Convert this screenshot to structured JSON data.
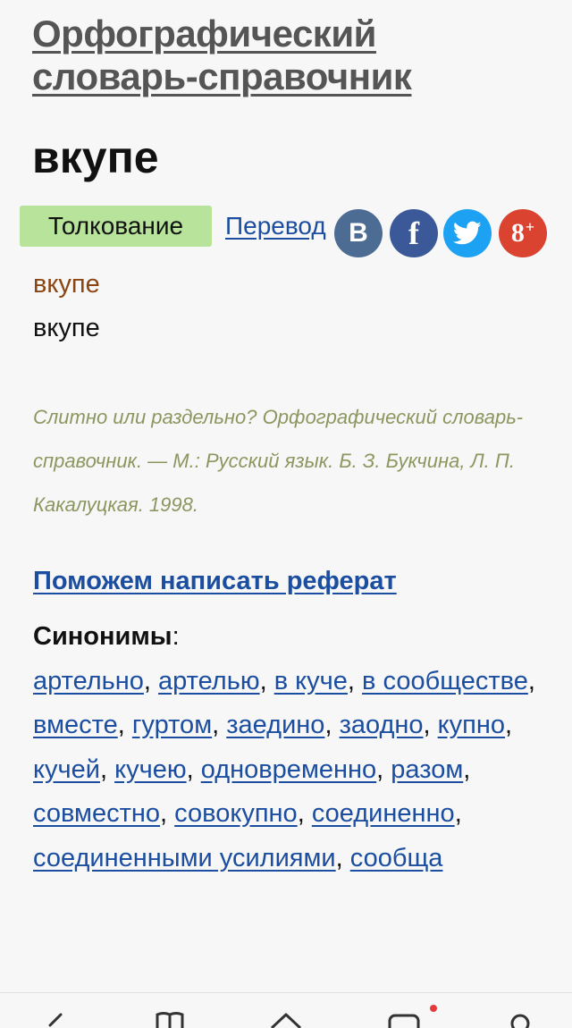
{
  "dictionary_title": "Орфографический словарь-справочник",
  "headword": "вкупе",
  "tabs": {
    "active": "Толкование",
    "link": "Перевод"
  },
  "social": {
    "vk": "В",
    "fb": "f",
    "gp": "8",
    "gp_plus": "+"
  },
  "entry": {
    "word": "вкупе",
    "text": "вкупе"
  },
  "source": "Слитно или раздельно? Орфографический словарь-справочник. — М.: Русский язык. Б. З. Букчина, Л. П. Какалуцкая. 1998.",
  "referat_link": "Поможем написать реферат",
  "synonyms": {
    "label": "Синонимы",
    "items": [
      "артельно",
      "артелью",
      "в куче",
      "в сообществе",
      "вместе",
      "гуртом",
      "заедино",
      "заодно",
      "купно",
      "кучей",
      "кучею",
      "одновременно",
      "разом",
      "совместно",
      "совокупно",
      "соединенно",
      "соединенными усилиями",
      "сообща"
    ]
  },
  "colors": {
    "link": "#1b4ea0",
    "entry_word": "#8b4513",
    "source": "#8c9760",
    "active_tab": "#b7e39a",
    "vk": "#4d6c93",
    "facebook": "#3b5998",
    "twitter": "#1da1f2",
    "google_plus": "#d9432f"
  },
  "bottom_nav": {
    "icons": [
      "back-icon",
      "bookmarks-icon",
      "home-icon",
      "tabs-icon",
      "profile-icon"
    ]
  }
}
